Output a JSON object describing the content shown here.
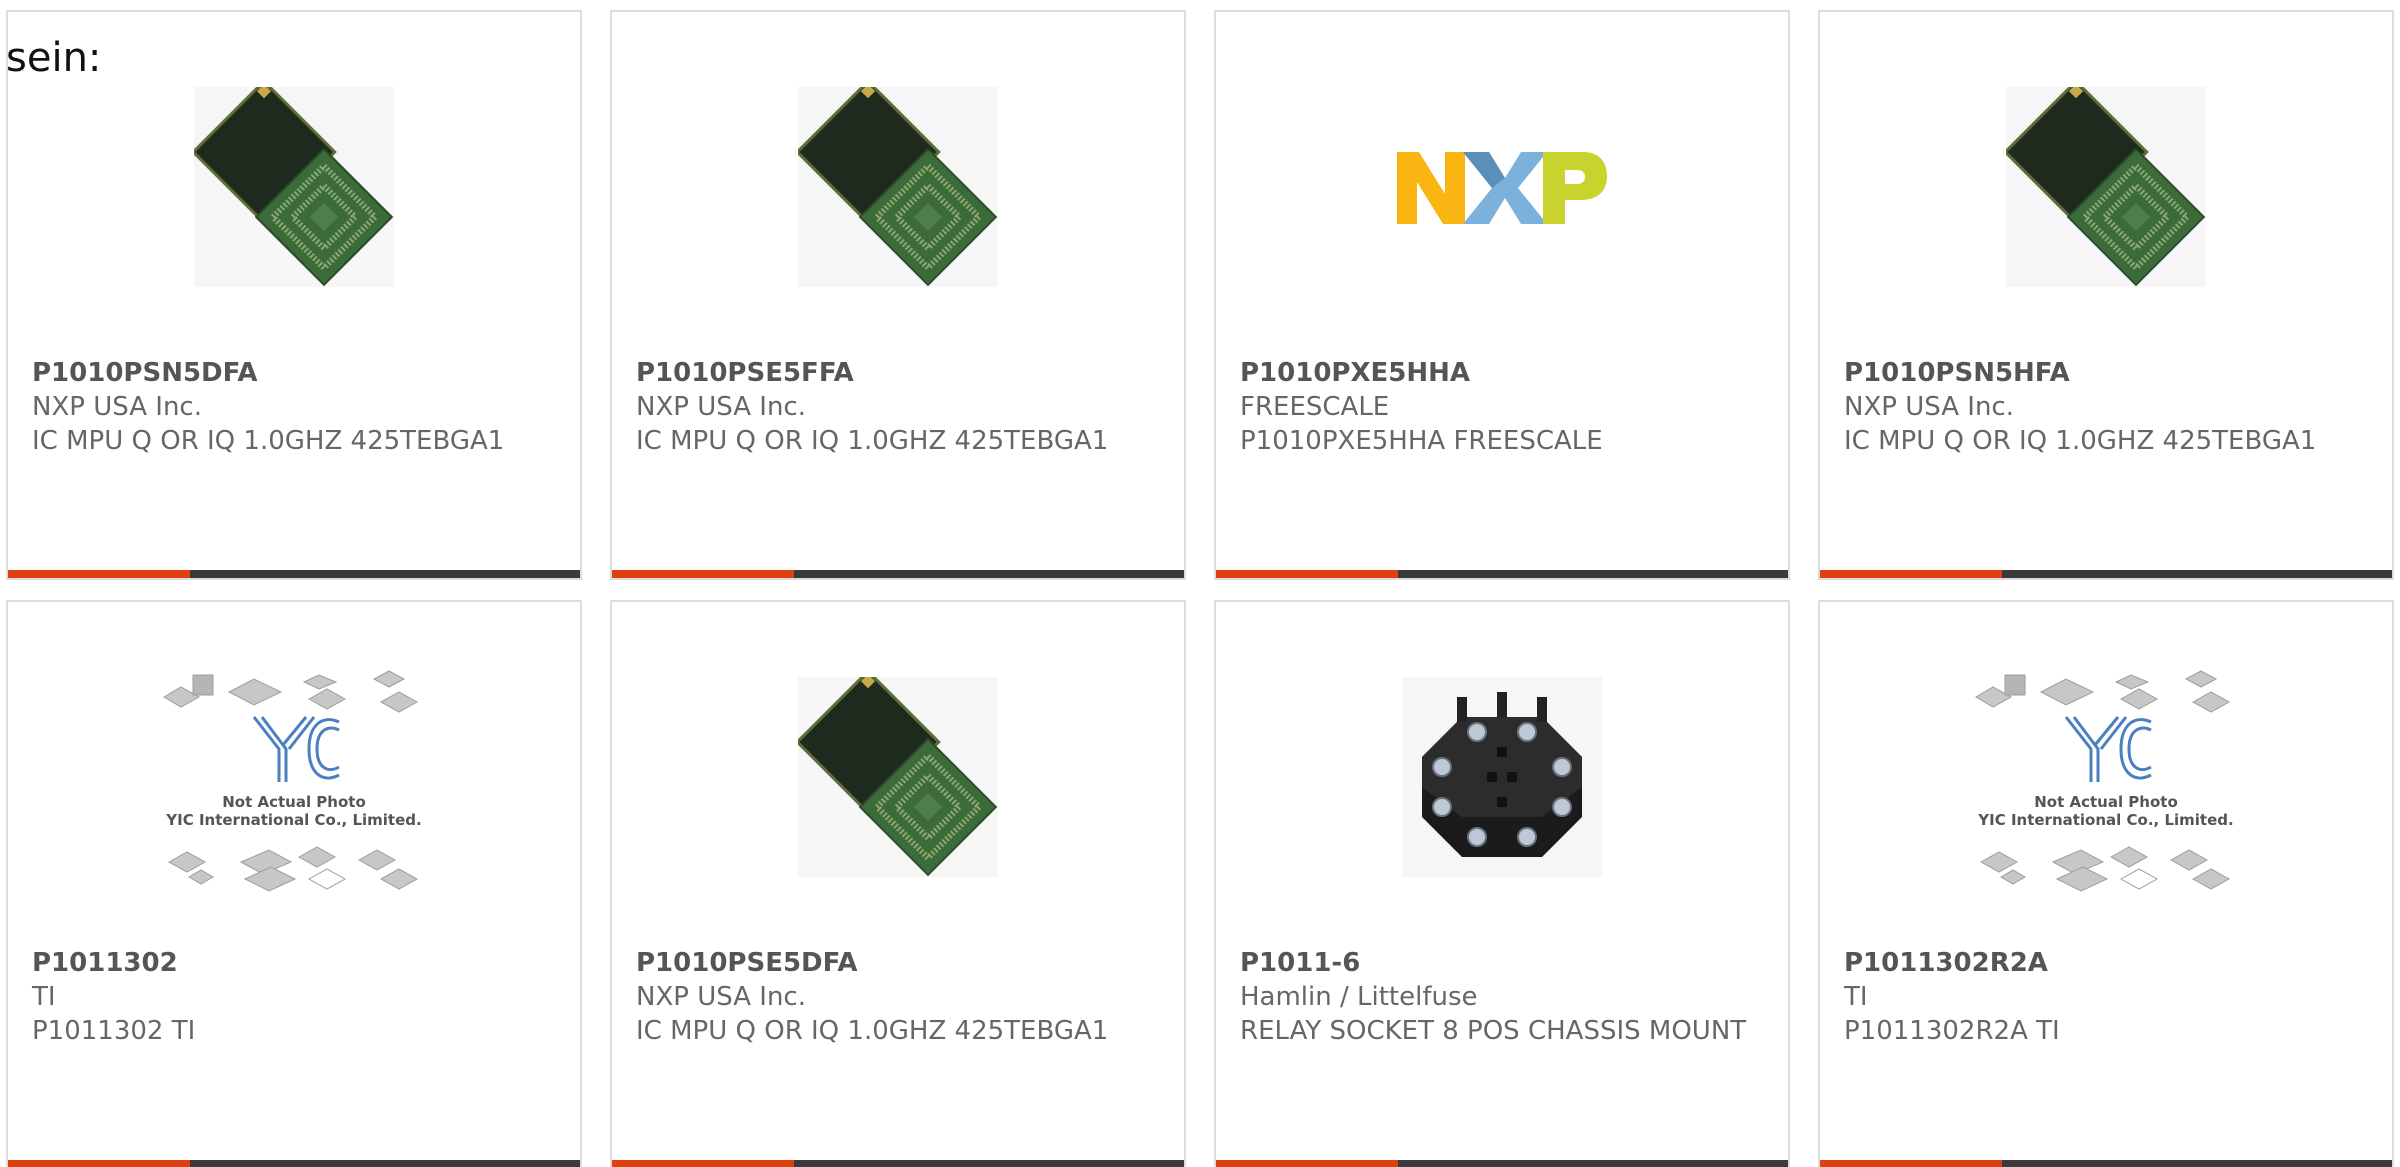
{
  "leading_text": "sein:",
  "colors": {
    "card_border": "#dcdcdc",
    "text_gray": "#666666",
    "bar_dark": "#3a3a3a",
    "bar_accent": "#e0400f"
  },
  "products": [
    {
      "part": "P1010PSN5DFA",
      "manufacturer": "NXP USA Inc.",
      "description": "IC MPU Q OR IQ 1.0GHZ 425TEBGA1",
      "image": "bga-chip-photo"
    },
    {
      "part": "P1010PSE5FFA",
      "manufacturer": "NXP USA Inc.",
      "description": "IC MPU Q OR IQ 1.0GHZ 425TEBGA1",
      "image": "bga-chip-photo"
    },
    {
      "part": "P1010PXE5HHA",
      "manufacturer": "FREESCALE",
      "description": "P1010PXE5HHA FREESCALE",
      "image": "nxp-logo"
    },
    {
      "part": "P1010PSN5HFA",
      "manufacturer": "NXP USA Inc.",
      "description": "IC MPU Q OR IQ 1.0GHZ 425TEBGA1",
      "image": "bga-chip-photo"
    },
    {
      "part": "P1011302",
      "manufacturer": "TI",
      "description": "P1011302 TI",
      "image": "yic-placeholder",
      "placeholder_line1": "Not Actual Photo",
      "placeholder_line2": "YIC International Co., Limited."
    },
    {
      "part": "P1010PSE5DFA",
      "manufacturer": "NXP USA Inc.",
      "description": "IC MPU Q OR IQ 1.0GHZ 425TEBGA1",
      "image": "bga-chip-photo"
    },
    {
      "part": "P1011-6",
      "manufacturer": "Hamlin / Littelfuse",
      "description": "RELAY SOCKET 8 POS CHASSIS MOUNT",
      "image": "relay-socket-photo"
    },
    {
      "part": "P1011302R2A",
      "manufacturer": "TI",
      "description": "P1011302R2A TI",
      "image": "yic-placeholder",
      "placeholder_line1": "Not Actual Photo",
      "placeholder_line2": "YIC International Co., Limited."
    }
  ]
}
